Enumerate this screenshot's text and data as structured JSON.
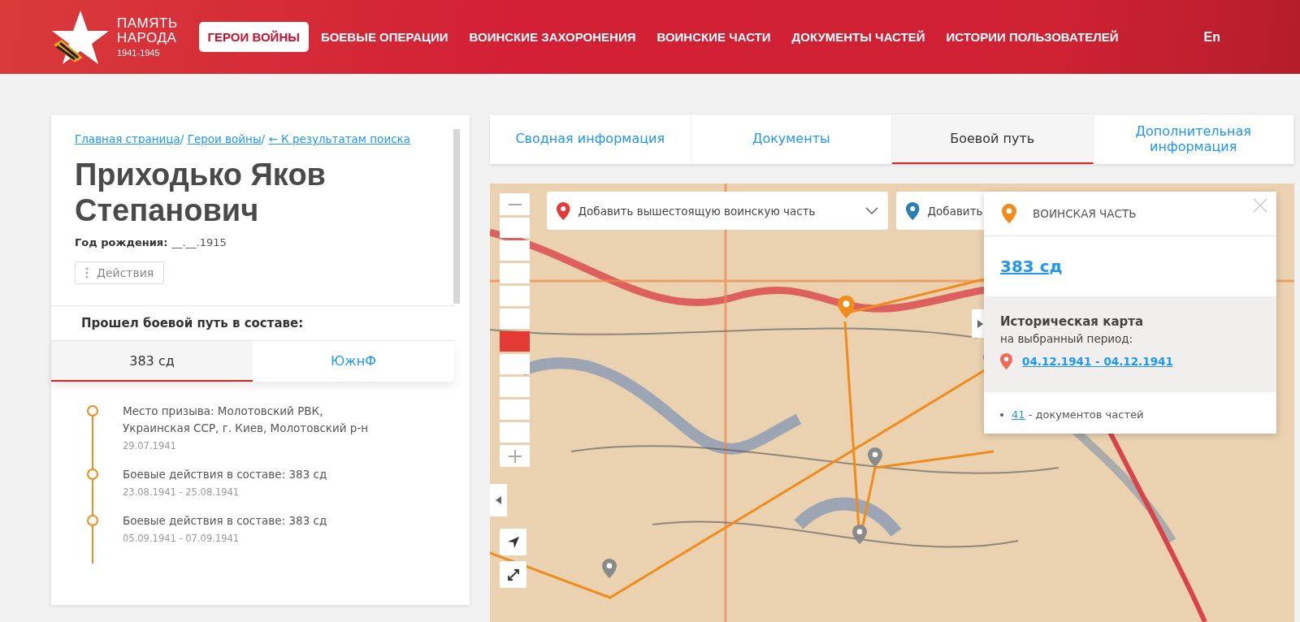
{
  "header": {
    "logo": {
      "line_1": "ПАМЯТЬ",
      "line_2": "НАРОДА",
      "years": "1941-1945"
    },
    "nav": [
      {
        "label": "ГЕРОИ ВОЙНЫ",
        "selected": true
      },
      {
        "label": "БОЕВЫЕ ОПЕРАЦИИ",
        "selected": false
      },
      {
        "label": "ВОИНСКИЕ ЗАХОРОНЕНИЯ",
        "selected": false
      },
      {
        "label": "ВОИНСКИЕ ЧАСТИ",
        "selected": false
      },
      {
        "label": "ДОКУМЕНТЫ ЧАСТЕЙ",
        "selected": false
      },
      {
        "label": "ИСТОРИИ ПОЛЬЗОВАТЕЛЕЙ",
        "selected": false
      }
    ],
    "language": "En"
  },
  "profile": {
    "breadcrumbs": [
      {
        "label": "Главная страница",
        "separator": "/"
      },
      {
        "label": "Герои войны",
        "separator": "/"
      },
      {
        "label": "← К результатам поиска"
      }
    ],
    "name": "Приходько Яков Степанович",
    "birth_label": "Год рождения:",
    "birth_value": "__.__.1915",
    "actions_button": "Действия",
    "path_title": "Прошел боевой путь в составе:",
    "unit_tabs": [
      {
        "label": "383 сд",
        "selected": true
      },
      {
        "label": "ЮжнФ",
        "selected": false
      }
    ],
    "timeline": [
      {
        "text": "Место призыва: Молотовский РВК, Украинская ССР, г. Киев, Молотовский р-н",
        "date": "29.07.1941"
      },
      {
        "text": "Боевые действия в составе: 383 сд",
        "date": "23.08.1941 - 25.08.1941"
      },
      {
        "text": "Боевые действия в составе: 383 сд",
        "date": "05.09.1941 - 07.09.1941"
      }
    ]
  },
  "tabs": [
    {
      "label": "Сводная информация",
      "selected": false
    },
    {
      "label": "Документы",
      "selected": false
    },
    {
      "label": "Боевой путь",
      "selected": true
    },
    {
      "label": "Дополнительная информация",
      "selected": false
    }
  ],
  "map": {
    "zoom": {
      "level": 0.4
    },
    "selectors": [
      {
        "label": "Добавить вышестоящую воинскую часть",
        "color": "#e53935",
        "dropdown": true
      },
      {
        "label": "Добавить",
        "color": "#2a7fb0",
        "dropdown": false
      }
    ],
    "popup": {
      "type": "ВОИНСКАЯ ЧАСТЬ",
      "unit": "383 сд",
      "map_title": "Историческая карта",
      "map_subtitle": "на выбранный период:",
      "period": "04.12.1941 - 04.12.1941",
      "doc_count": "41",
      "doc_label": " - документов частей"
    }
  }
}
